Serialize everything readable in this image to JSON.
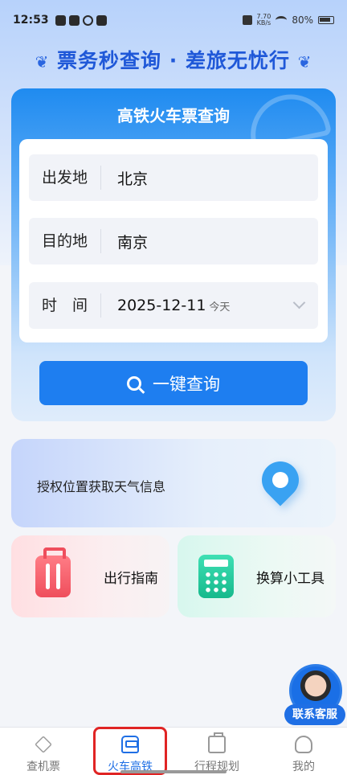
{
  "status_bar": {
    "time": "12:53",
    "net_speed_value": "7.70",
    "net_speed_unit": "KB/s",
    "battery": "80%"
  },
  "slogan": "票务秒查询 · 差旅无忧行",
  "search_card": {
    "title": "高铁火车票查询",
    "departure_label": "出发地",
    "departure_value": "北京",
    "destination_label": "目的地",
    "destination_value": "南京",
    "time_label": "时　间",
    "date_value": "2025-12-11",
    "date_hint": "今天",
    "search_button": "一键查询"
  },
  "weather": {
    "text": "授权位置获取天气信息",
    "icon": "location-pin-icon"
  },
  "features": [
    {
      "label": "出行指南",
      "icon": "suitcase-icon",
      "color": "#ef4e5c"
    },
    {
      "label": "换算小工具",
      "icon": "calculator-icon",
      "color": "#16b98c"
    }
  ],
  "customer_service": {
    "label": "联系客服"
  },
  "tabs": [
    {
      "label": "查机票",
      "icon": "plane-icon"
    },
    {
      "label": "火车高铁",
      "icon": "train-icon",
      "active": true
    },
    {
      "label": "行程规划",
      "icon": "briefcase-icon"
    },
    {
      "label": "我的",
      "icon": "user-icon"
    }
  ],
  "colors": {
    "primary": "#1e7ef0",
    "slogan": "#1f58d8",
    "highlight": "#e02424"
  }
}
